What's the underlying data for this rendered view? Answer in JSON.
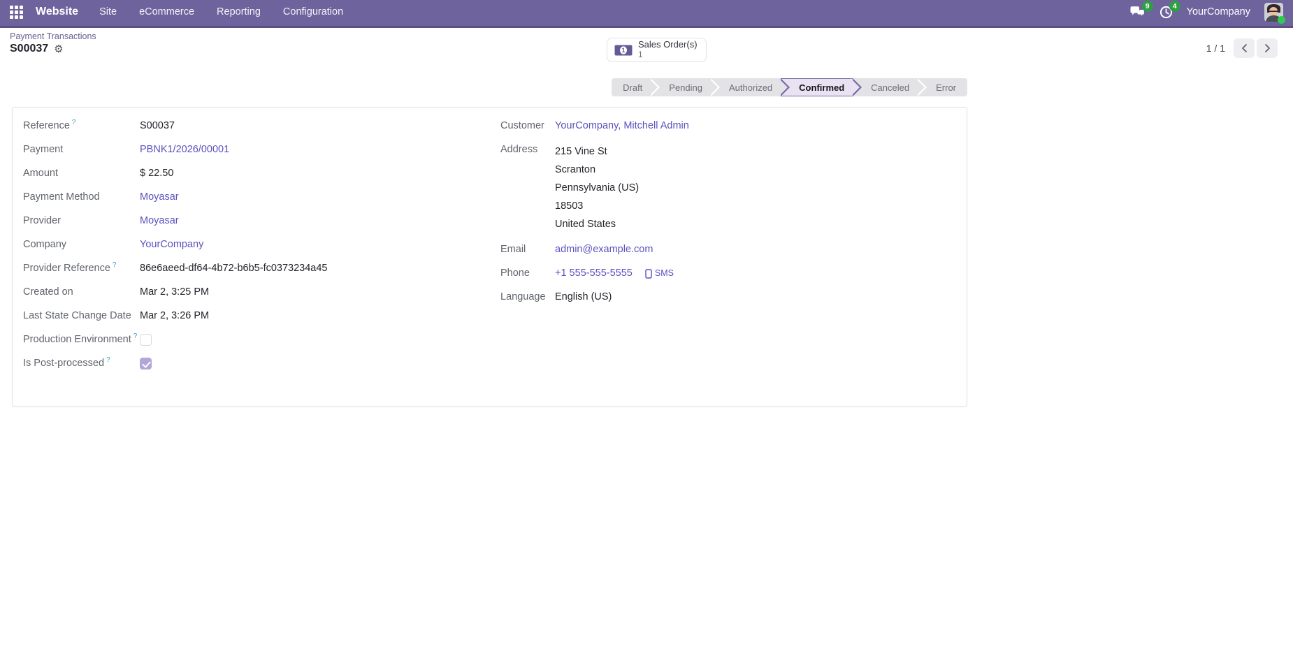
{
  "navbar": {
    "brand": "Website",
    "menus": [
      "Site",
      "eCommerce",
      "Reporting",
      "Configuration"
    ],
    "messages_badge": "9",
    "activities_badge": "4",
    "company": "YourCompany"
  },
  "control_panel": {
    "breadcrumb": "Payment Transactions",
    "title": "S00037",
    "smart_button": {
      "label": "Sales Order(s)",
      "count": "1"
    },
    "pager": {
      "value": "1 / 1"
    }
  },
  "statusbar": {
    "steps": [
      {
        "label": "Draft",
        "active": false
      },
      {
        "label": "Pending",
        "active": false
      },
      {
        "label": "Authorized",
        "active": false
      },
      {
        "label": "Confirmed",
        "active": true
      },
      {
        "label": "Canceled",
        "active": false
      },
      {
        "label": "Error",
        "active": false
      }
    ]
  },
  "form": {
    "left_rows": [
      {
        "label": "Reference",
        "help": true,
        "value": "S00037",
        "type": "text"
      },
      {
        "label": "Payment",
        "value": "PBNK1/2026/00001",
        "type": "link"
      },
      {
        "label": "Amount",
        "value": "$ 22.50",
        "type": "text"
      },
      {
        "label": "Payment Method",
        "value": "Moyasar",
        "type": "link"
      },
      {
        "label": "Provider",
        "value": "Moyasar",
        "type": "link"
      },
      {
        "label": "Company",
        "value": "YourCompany",
        "type": "link"
      },
      {
        "label": "Provider Reference",
        "help": true,
        "value": "86e6aeed-df64-4b72-b6b5-fc0373234a45",
        "type": "text"
      },
      {
        "label": "Created on",
        "value": "Mar 2, 3:25 PM",
        "type": "text"
      },
      {
        "label": "Last State Change Date",
        "value": "Mar 2, 3:26 PM",
        "type": "text"
      },
      {
        "label": "Production Environment",
        "help": true,
        "type": "checkbox",
        "checked": false
      },
      {
        "label": "Is Post-processed",
        "help": true,
        "type": "checkbox",
        "checked": true
      }
    ],
    "right": {
      "customer_label": "Customer",
      "customer": "YourCompany, Mitchell Admin",
      "address_label": "Address",
      "address_lines": [
        "215 Vine St",
        "Scranton",
        "Pennsylvania (US)",
        "18503",
        "United States"
      ],
      "email_label": "Email",
      "email": "admin@example.com",
      "phone_label": "Phone",
      "phone": "+1 555-555-5555",
      "sms_label": "SMS",
      "language_label": "Language",
      "language": "English (US)"
    }
  },
  "icons": {
    "gear": "⚙",
    "help": "?"
  },
  "colors": {
    "navbar": "#6e639d",
    "navbar_border": "#5a5086",
    "link": "#5b51bd",
    "badge_green": "#2f9e44",
    "presence_green": "#2ecc4e",
    "step_bg": "#e3e3e6",
    "step_active_bg": "#e8e2f2",
    "step_active_border": "#7668a5",
    "checkbox_checked": "#b3a6d9",
    "help": "#2ea3bf"
  }
}
